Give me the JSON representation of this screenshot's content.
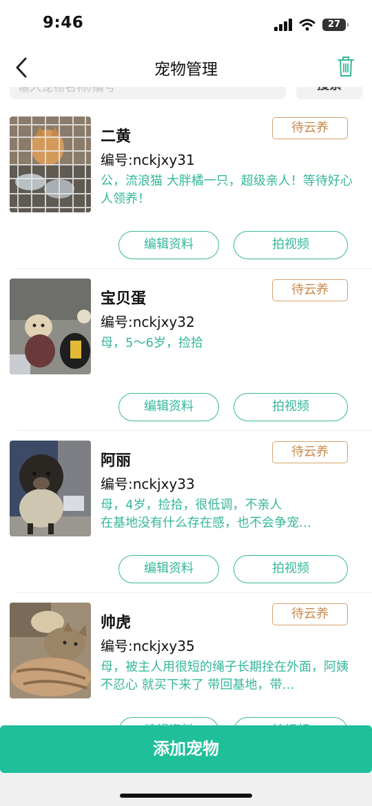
{
  "status_bar": {
    "time": "9:46",
    "battery": "27"
  },
  "nav": {
    "title": "宠物管理"
  },
  "search": {
    "placeholder": "输入宠物名称/编号",
    "button_label": "搜索"
  },
  "pets": [
    {
      "name": "二黄",
      "number": "编号:nckjxy31",
      "description": "公，流浪猫 大胖橘一只，超级亲人！等待好心人领养！",
      "status": "待云养",
      "edit_label": "编辑资料",
      "video_label": "拍视频"
    },
    {
      "name": "宝贝蛋",
      "number": "编号:nckjxy32",
      "description": "母，5～6岁，捡拾",
      "status": "待云养",
      "edit_label": "编辑资料",
      "video_label": "拍视频"
    },
    {
      "name": "阿丽",
      "number": "编号:nckjxy33",
      "description": "母，4岁，捡拾，很低调，不亲人\n在基地没有什么存在感，也不会争宠…",
      "status": "待云养",
      "edit_label": "编辑资料",
      "video_label": "拍视频"
    },
    {
      "name": "帅虎",
      "number": "编号:nckjxy35",
      "description": "母，被主人用很短的绳子长期拴在外面，阿姨不忍心 就买下来了 带回基地，带…",
      "status": "待云养",
      "edit_label": "编辑资料",
      "video_label": "拍视频"
    }
  ],
  "footer": {
    "add_label": "添加宠物"
  },
  "colors": {
    "accent": "#1fbf9a",
    "text_green": "#35b79a",
    "badge_orange": "#c8884d"
  }
}
